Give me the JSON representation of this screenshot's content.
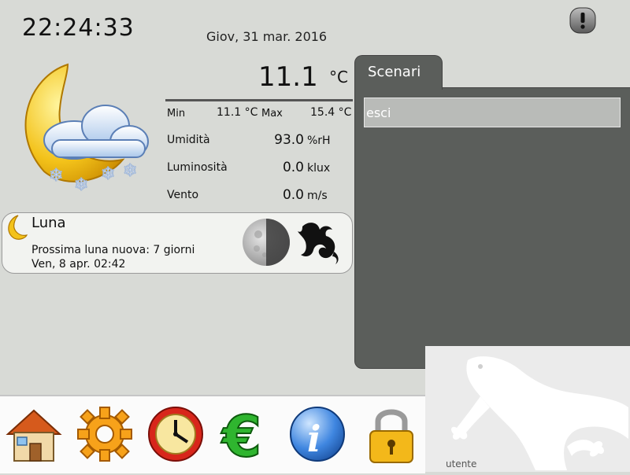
{
  "header": {
    "time": "22:24:33",
    "date": "Giov, 31 mar. 2016",
    "alert_icon": "warning-icon"
  },
  "weather": {
    "icon": "moon-cloud-snow-icon",
    "temperature": "11.1",
    "temperature_unit": "°C",
    "min_label": "Min",
    "min_value": "11.1 °C",
    "max_label": "Max",
    "max_value": "15.4 °C",
    "rows": [
      {
        "label": "Umidità",
        "value": "93.0",
        "unit": "%rH"
      },
      {
        "label": "Luminosità",
        "value": "0.0",
        "unit": "klux"
      },
      {
        "label": "Vento",
        "value": "0.0",
        "unit": "m/s"
      }
    ]
  },
  "moon": {
    "title": "Luna",
    "next_new_moon": "Prossima luna nuova: 7 giorni",
    "date": "Ven, 8 apr. 02:42",
    "phase_icon": "moon-phase-icon",
    "zodiac_icon": "capricorn-icon"
  },
  "scenari": {
    "tab_label": "Scenari",
    "items": [
      "esci"
    ]
  },
  "dock": {
    "items": [
      "home-icon",
      "settings-gear-icon",
      "clock-icon",
      "euro-icon",
      "info-icon",
      "lock-icon"
    ]
  },
  "user": {
    "label": "utente"
  },
  "colors": {
    "background": "#d8dad6",
    "panel": "#5b5e5b",
    "selected_item": "#b9bbb8"
  }
}
